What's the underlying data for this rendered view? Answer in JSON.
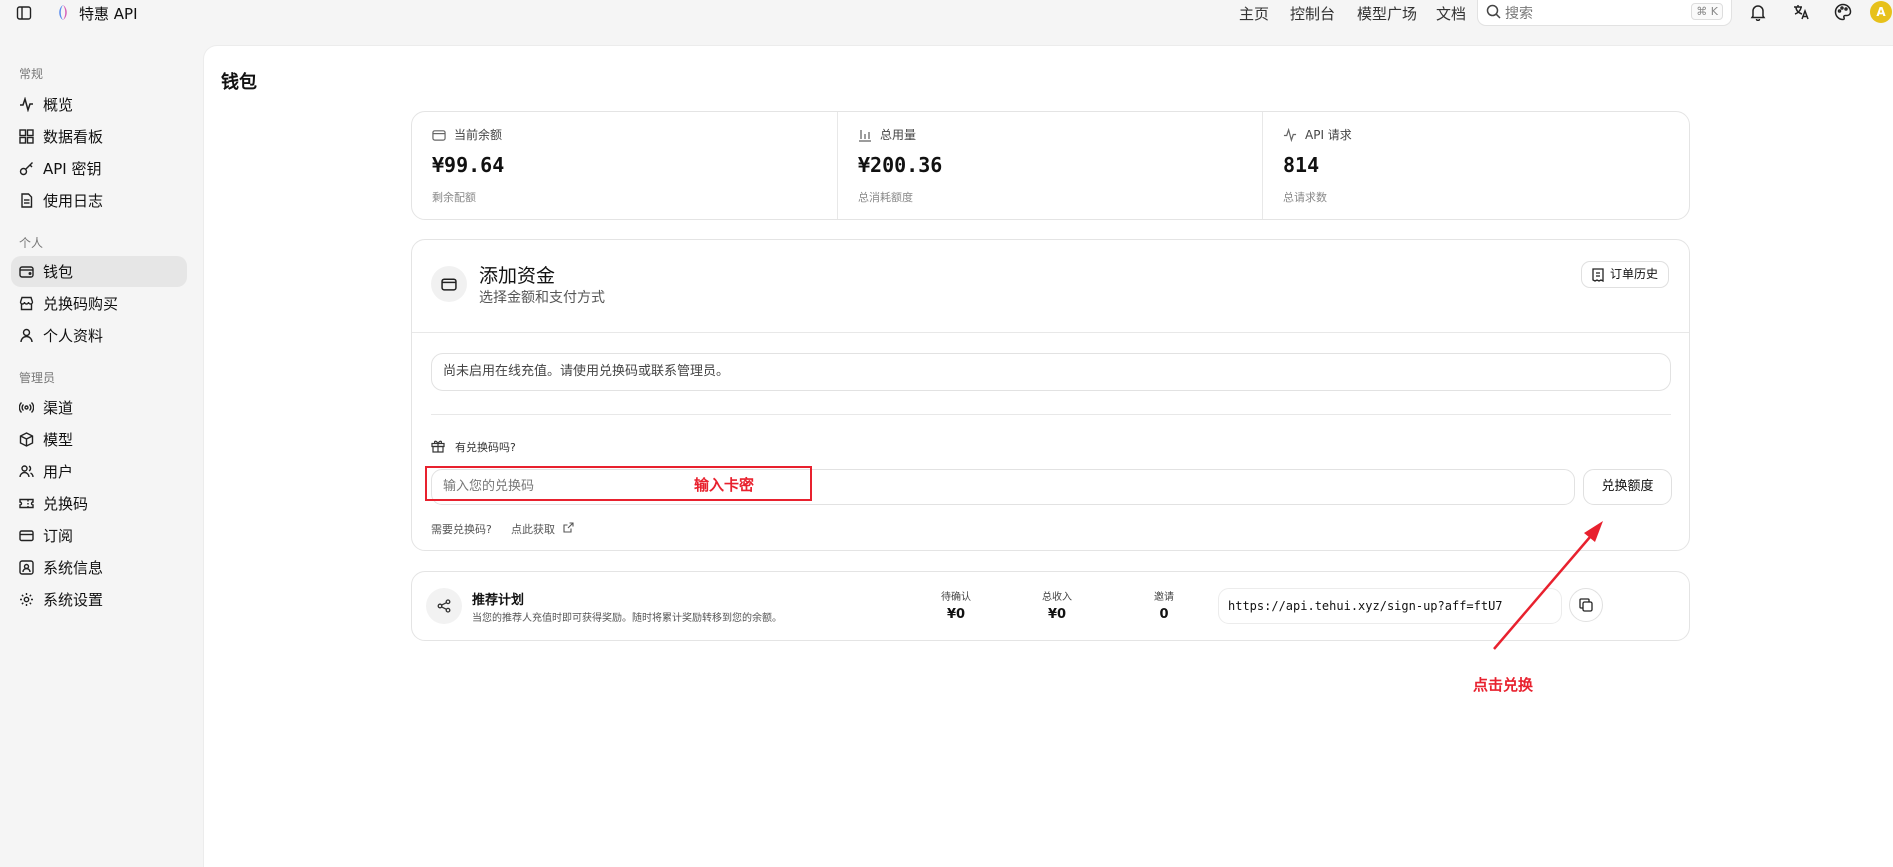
{
  "topbar": {
    "app_name": "特惠 API",
    "nav": [
      "主页",
      "控制台",
      "模型广场",
      "文档"
    ],
    "search_placeholder": "搜索",
    "search_shortcut": "⌘ K",
    "avatar_letter": "A"
  },
  "sidebar": {
    "sections": [
      {
        "title": "常规",
        "items": [
          {
            "label": "概览",
            "icon": "activity-icon"
          },
          {
            "label": "数据看板",
            "icon": "grid-icon"
          },
          {
            "label": "API 密钥",
            "icon": "key-icon"
          },
          {
            "label": "使用日志",
            "icon": "file-icon"
          }
        ]
      },
      {
        "title": "个人",
        "items": [
          {
            "label": "钱包",
            "icon": "wallet-icon",
            "active": true
          },
          {
            "label": "兑换码购买",
            "icon": "store-icon"
          },
          {
            "label": "个人资料",
            "icon": "user-icon"
          }
        ]
      },
      {
        "title": "管理员",
        "items": [
          {
            "label": "渠道",
            "icon": "radio-icon"
          },
          {
            "label": "模型",
            "icon": "box-icon"
          },
          {
            "label": "用户",
            "icon": "users-icon"
          },
          {
            "label": "兑换码",
            "icon": "ticket-icon"
          },
          {
            "label": "订阅",
            "icon": "card-icon"
          },
          {
            "label": "系统信息",
            "icon": "info-icon"
          },
          {
            "label": "系统设置",
            "icon": "settings-icon"
          }
        ]
      }
    ]
  },
  "main": {
    "title": "钱包",
    "stats": [
      {
        "label": "当前余额",
        "value": "¥99.64",
        "sub": "剩余配额",
        "icon": "wallet-icon"
      },
      {
        "label": "总用量",
        "value": "¥200.36",
        "sub": "总消耗额度",
        "icon": "bar-chart-icon"
      },
      {
        "label": "API 请求",
        "value": "814",
        "sub": "总请求数",
        "icon": "activity-icon"
      }
    ],
    "fund": {
      "title": "添加资金",
      "subtitle": "选择金额和支付方式",
      "order_history": "订单历史",
      "notice": "尚未启用在线充值。请使用兑换码或联系管理员。",
      "has_code": "有兑换码吗?",
      "code_placeholder": "输入您的兑换码",
      "redeem_button": "兑换额度",
      "need_code": "需要兑换码?",
      "get_link": "点此获取"
    },
    "referral": {
      "title": "推荐计划",
      "subtitle": "当您的推荐人充值时即可获得奖励。随时将累计奖励转移到您的余额。",
      "metrics": [
        {
          "label": "待确认",
          "value": "¥0"
        },
        {
          "label": "总收入",
          "value": "¥0"
        },
        {
          "label": "邀请",
          "value": "0"
        }
      ],
      "url": "https://api.tehui.xyz/sign-up?aff=ftU7"
    }
  },
  "annotations": {
    "input_note": "输入卡密",
    "click_note": "点击兑换",
    "color": "#e8212e"
  }
}
